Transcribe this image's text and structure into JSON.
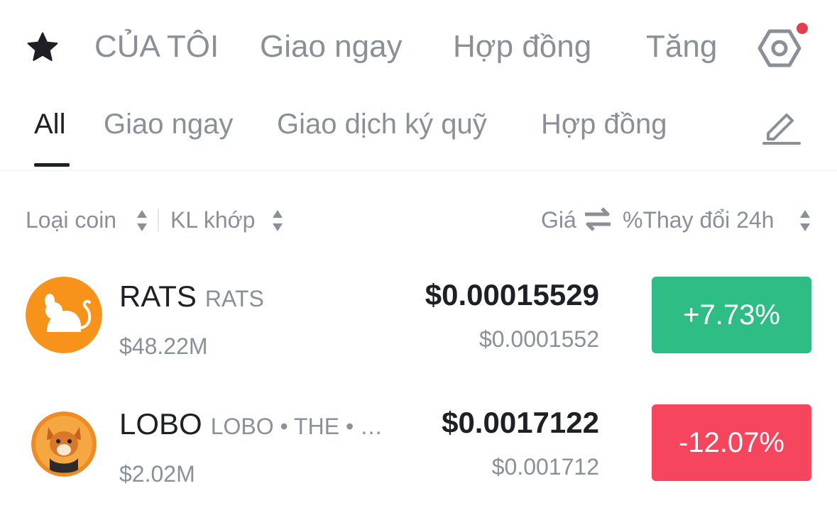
{
  "top_nav": {
    "tabs": [
      "CỦA TÔI",
      "Giao ngay",
      "Hợp đồng",
      "Tăng"
    ]
  },
  "sub_tabs": [
    "All",
    "Giao ngay",
    "Giao dịch ký quỹ",
    "Hợp đồng"
  ],
  "columns": {
    "coin": "Loại coin",
    "volume": "KL khớp",
    "price": "Giá",
    "change": "%Thay đổi 24h"
  },
  "rows": [
    {
      "symbol": "RATS",
      "tags": "RATS",
      "volume": "$48.22M",
      "price": "$0.00015529",
      "price_usd": "$0.0001552",
      "change": "+7.73%",
      "direction": "up"
    },
    {
      "symbol": "LOBO",
      "tags": "LOBO • THE • …",
      "volume": "$2.02M",
      "price": "$0.0017122",
      "price_usd": "$0.001712",
      "change": "-12.07%",
      "direction": "down"
    }
  ],
  "colors": {
    "up": "#2ebd85",
    "down": "#f6465d",
    "accent_dot": "#e43f51"
  },
  "icons": [
    "star-icon",
    "settings-hexagon-icon",
    "edit-pencil-icon",
    "sort-icon",
    "swap-icon"
  ]
}
